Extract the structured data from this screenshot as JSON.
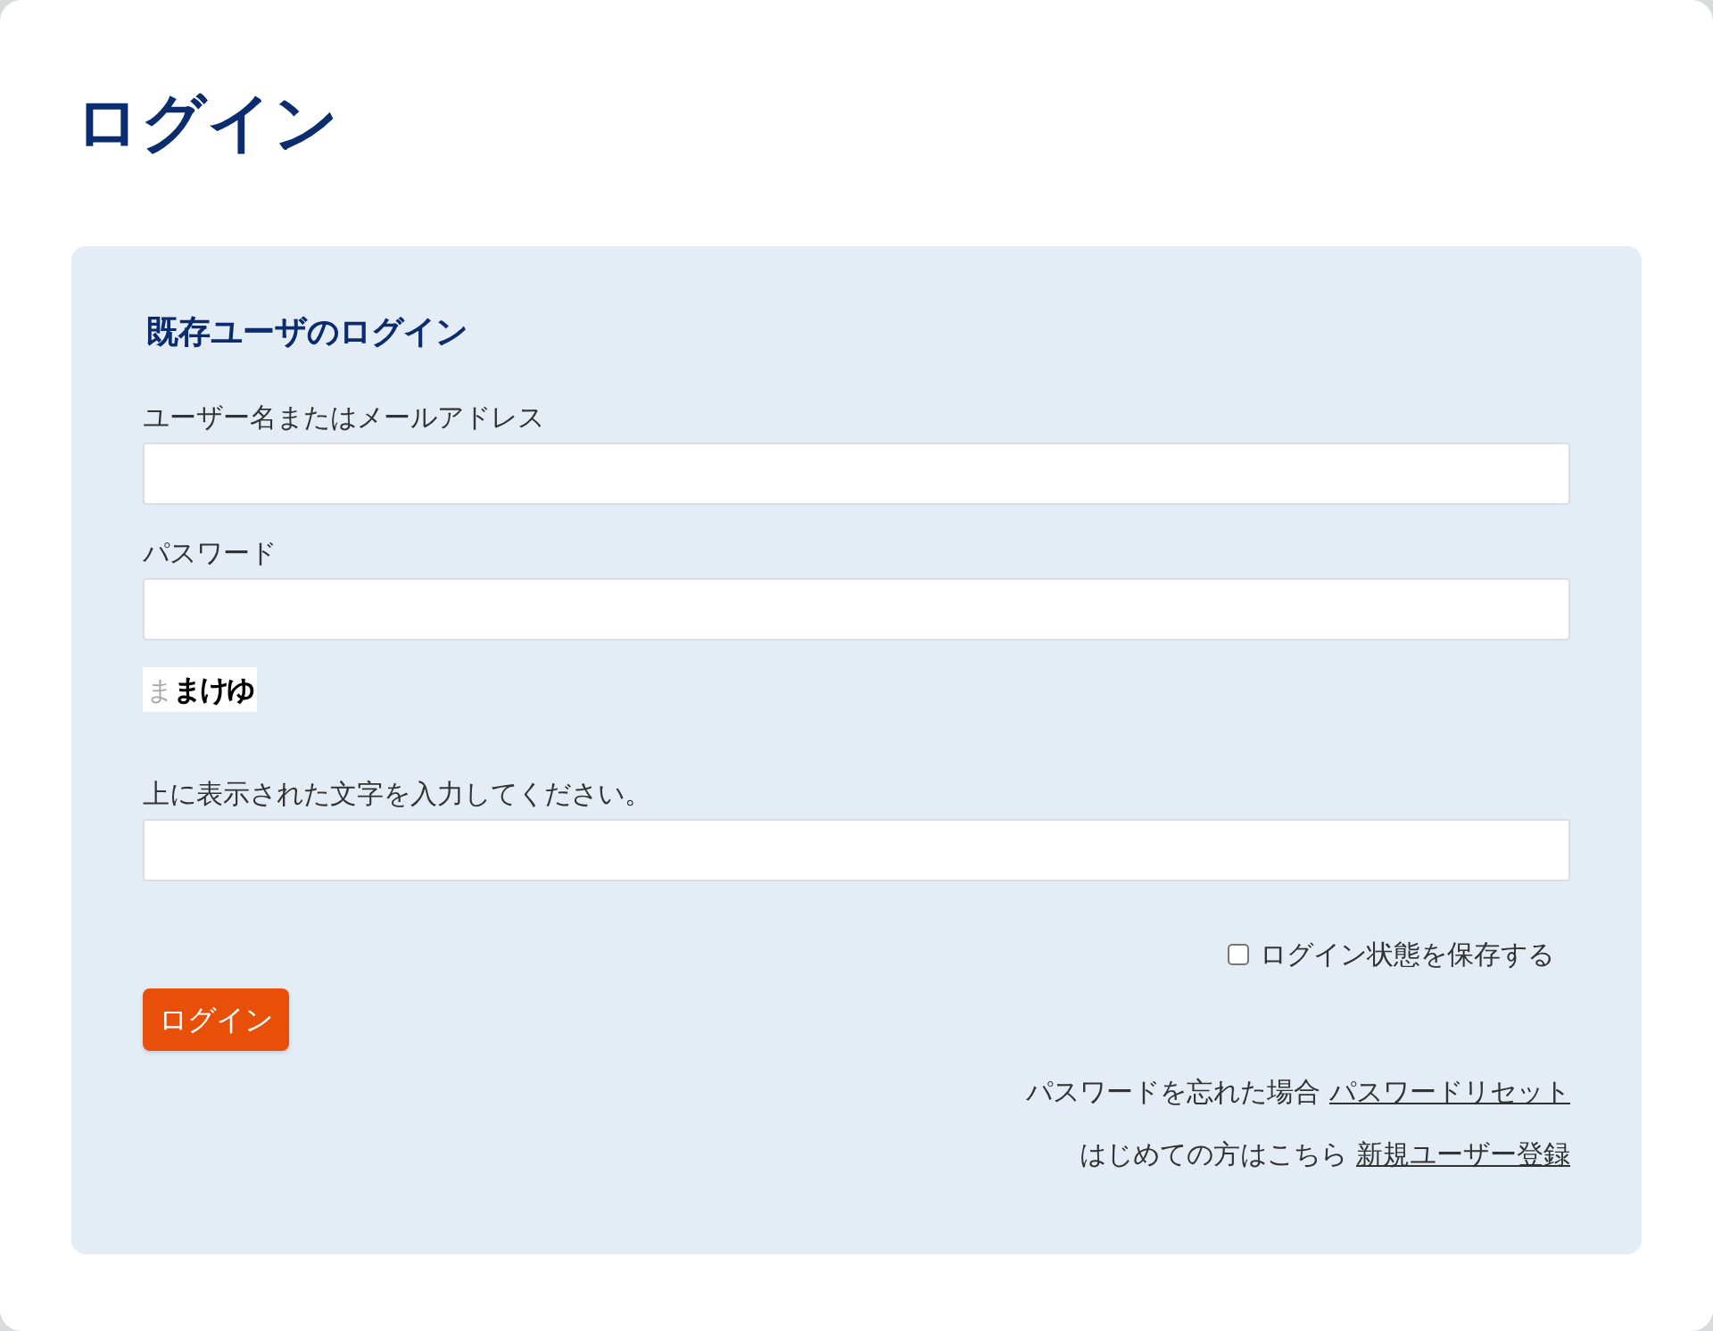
{
  "page": {
    "title": "ログイン"
  },
  "login_panel": {
    "heading": "既存ユーザのログイン",
    "items": [
      {
        "kind": "field",
        "label": "ユーザー名またはメールアドレス"
      },
      {
        "kind": "field",
        "label": "パスワード"
      },
      {
        "kind": "captcha",
        "faint_text": "ま",
        "text": "まけゆ"
      },
      {
        "kind": "field",
        "label": "上に表示された文字を入力してください。"
      }
    ],
    "remember": {
      "label": "ログイン状態を保存する",
      "checked": false
    },
    "submit": "ログイン",
    "links": [
      {
        "text": "パスワードを忘れた場合",
        "link": "パスワードリセット"
      },
      {
        "text": "はじめての方はこちら",
        "link": "新規ユーザー登録"
      }
    ]
  }
}
